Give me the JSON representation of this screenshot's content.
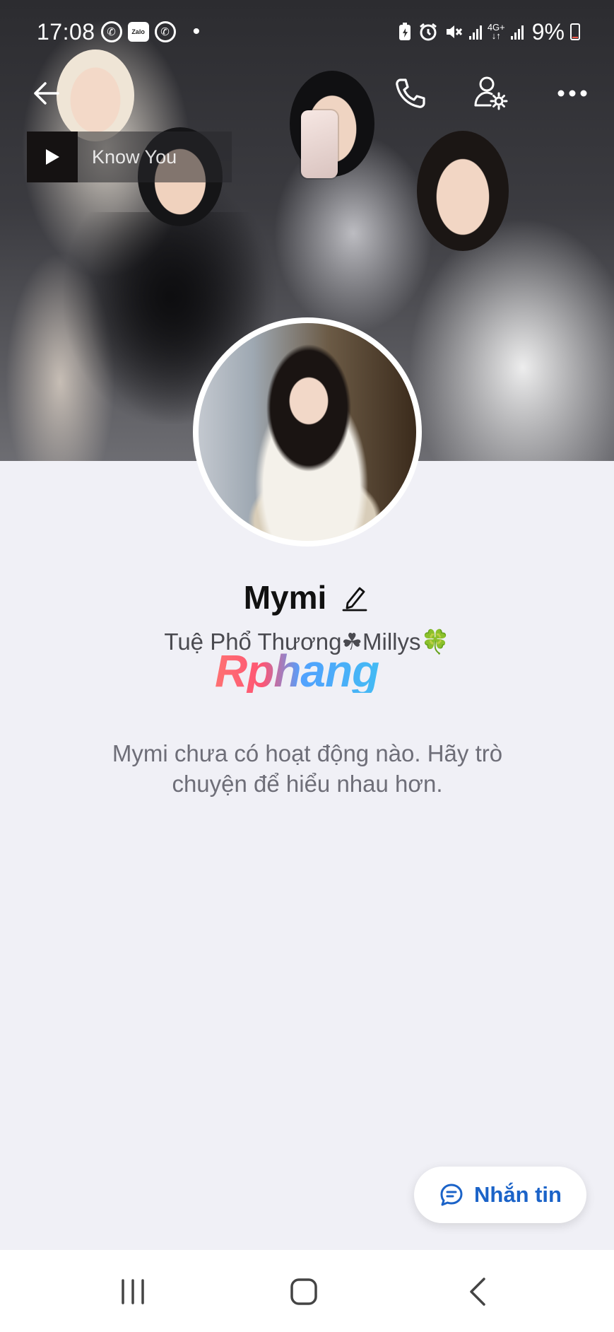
{
  "status_bar": {
    "time": "17:08",
    "zalo_label": "Zalo",
    "network_top": "4G+",
    "network_bottom": "↓↑",
    "battery_percent": "9%"
  },
  "header": {
    "back_icon": "arrow-left-icon",
    "call_icon": "phone-icon",
    "settings_icon": "user-settings-icon",
    "more_icon": "more-horizontal-icon"
  },
  "music": {
    "title": "Know    You"
  },
  "profile": {
    "name": "Mymi",
    "bio": "Tuệ Phổ Thương☘Millys",
    "bio_emoji": "🍀",
    "watermark": "Rphang",
    "empty_message": "Mymi chưa có hoạt động nào. Hãy trò chuyện để hiểu nhau hơn."
  },
  "actions": {
    "message_label": "Nhắn tin"
  },
  "colors": {
    "background": "#f0f0f6",
    "accent": "#1b63c8"
  }
}
